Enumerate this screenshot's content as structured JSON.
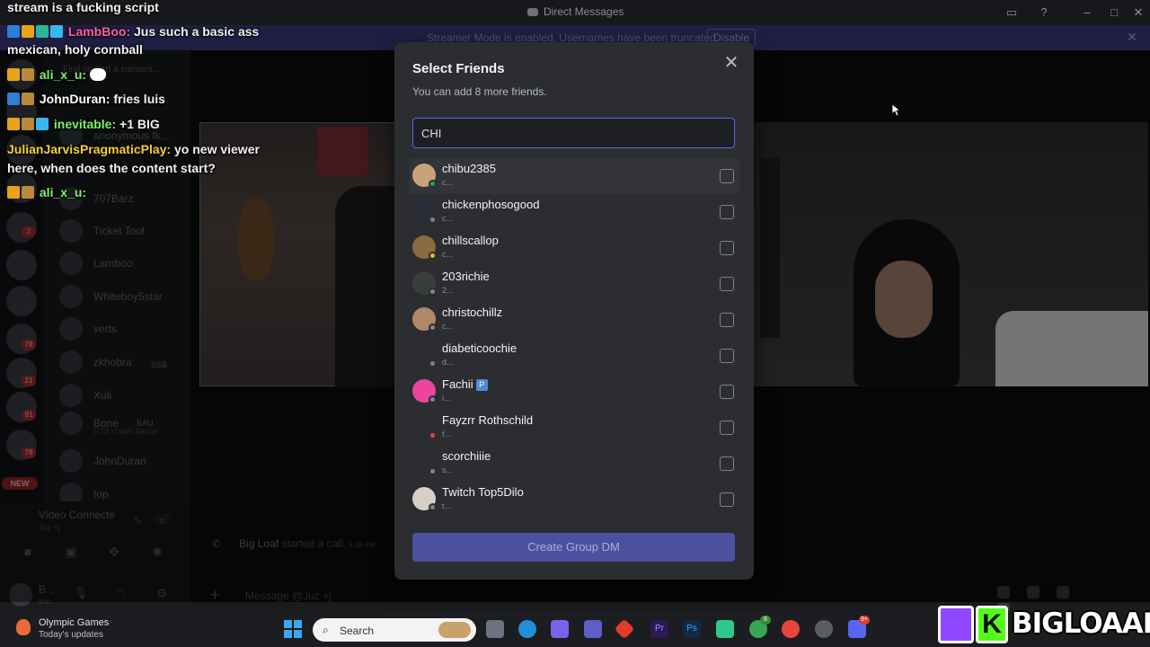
{
  "window": {
    "title": "Direct Messages"
  },
  "banner": {
    "text": "Streamer Mode is enabled. Usernames have been truncated.",
    "disable_label": "Disable"
  },
  "sidebar": {
    "search_placeholder": "Find or start a convers...",
    "dms": [
      {
        "name": "anonymous fk..."
      },
      {
        "name": "707Barz"
      },
      {
        "name": "Ticket Tool"
      },
      {
        "name": "Lamboo"
      },
      {
        "name": "Whiteboy5star"
      },
      {
        "name": "verts"
      },
      {
        "name": "zkhobra",
        "tag": "SSB"
      },
      {
        "name": "Xuli"
      },
      {
        "name": "Bone",
        "sub": "GTA V with Medal",
        "tag": "BAU"
      },
      {
        "name": "JohnDuran"
      },
      {
        "name": "top"
      }
    ],
    "server_badges": [
      "2",
      "78",
      "21",
      "91",
      "78"
    ],
    "new_label": "NEW",
    "voice": {
      "label": "Video Connecte",
      "sub": "Juz +j"
    },
    "user": {
      "name": "B...",
      "status": "Inv..."
    }
  },
  "chat_overlay": {
    "lines": [
      {
        "user": "",
        "text": "stream is a fucking script"
      },
      {
        "user": "LambBoo:",
        "text": "Jus such a basic ass"
      },
      {
        "user": "",
        "text": "mexican, holy cornball"
      },
      {
        "user": "ali_x_u:",
        "text": ""
      },
      {
        "user": "JohnDuran:",
        "text": "fries luis"
      },
      {
        "user": "inevitable:",
        "text": "+1 BIG"
      },
      {
        "user": "JulianJarvisPragmaticPlay:",
        "text": "yo new viewer"
      },
      {
        "user": "",
        "text": "here, when does the content start?"
      },
      {
        "user": "ali_x_u:",
        "text": ""
      }
    ],
    "colors": {
      "lambboo": "#ff5fa8",
      "ali": "#7df36a",
      "johnduran": "#ffffff",
      "inevitable": "#7df36a",
      "julian": "#f6cf3b"
    }
  },
  "modal": {
    "title": "Select Friends",
    "subtitle": "You can add 8 more friends.",
    "search_value": "CHI",
    "create_label": "Create Group DM",
    "friends": [
      {
        "name": "chibu2385",
        "sub": "c...",
        "status": "online"
      },
      {
        "name": "chickenphosogood",
        "sub": "c...",
        "status": "offline"
      },
      {
        "name": "chillscallop",
        "sub": "c...",
        "status": "idle"
      },
      {
        "name": "203richie",
        "sub": "2...",
        "status": "offline"
      },
      {
        "name": "christochillz",
        "sub": "c...",
        "status": "offline"
      },
      {
        "name": "diabeticoochie",
        "sub": "d...",
        "status": "offline"
      },
      {
        "name": "Fachii",
        "sub": "i...",
        "status": "offline",
        "badge": "P"
      },
      {
        "name": "Fayzrr Rothschild",
        "sub": "f...",
        "status": "dnd"
      },
      {
        "name": "scorchiiie",
        "sub": "s...",
        "status": "offline"
      },
      {
        "name": "Twitch Top5Dilo",
        "sub": "t...",
        "status": "offline"
      }
    ]
  },
  "call": {
    "caller": "Big Loaf",
    "action": "started a call.",
    "time": "6:08 PM",
    "message_placeholder": "Message @Juz +j"
  },
  "taskbar": {
    "weather_title": "Olympic Games",
    "weather_sub": "Today's updates",
    "search_label": "Search",
    "badges": [
      "6",
      "9+"
    ]
  },
  "logo": {
    "k_letter": "K",
    "text": "BIGLOAAF"
  }
}
